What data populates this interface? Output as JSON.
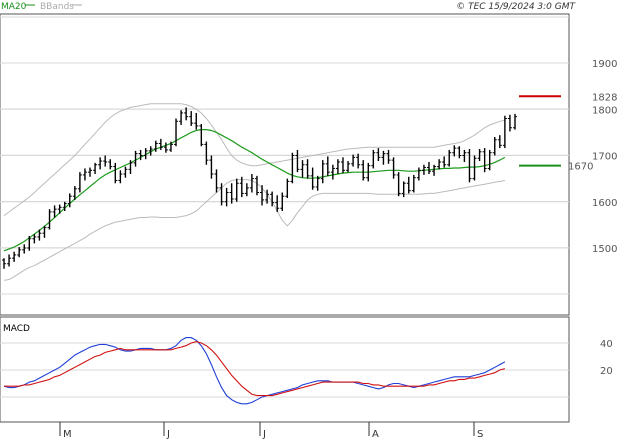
{
  "header": {
    "legend": [
      {
        "label": "MA20",
        "color": "#1a8f1a"
      },
      {
        "label": "BBands",
        "color": "#aaaaaa"
      }
    ],
    "copyright": "© TEC 15/9/2024 3:0 GMT"
  },
  "colors": {
    "price": "#000000",
    "ma20": "#1a9a1a",
    "bbands": "#bbbbbb",
    "grid": "#d8d8d8",
    "resistance": "#cc0000",
    "support": "#1a8f1a",
    "macd": "#1f3fd6",
    "signal": "#d01010"
  },
  "chart_data": [
    {
      "type": "line",
      "ylim": [
        1420,
        1950
      ],
      "yticks": [
        1500,
        1600,
        1700,
        1800,
        1900
      ],
      "xtick_labels": [
        "M",
        "J",
        "J",
        "A",
        "S"
      ],
      "levels": [
        {
          "label": "1828",
          "value": 1828,
          "color": "#cc0000"
        },
        {
          "label": "1670",
          "value": 1678,
          "color": "#1a8f1a"
        }
      ],
      "ohlc": [
        [
          1474,
          1478,
          1455,
          1466
        ],
        [
          1466,
          1486,
          1460,
          1478
        ],
        [
          1478,
          1492,
          1470,
          1485
        ],
        [
          1485,
          1502,
          1480,
          1496
        ],
        [
          1496,
          1508,
          1488,
          1500
        ],
        [
          1500,
          1526,
          1494,
          1520
        ],
        [
          1520,
          1530,
          1510,
          1524
        ],
        [
          1524,
          1540,
          1516,
          1532
        ],
        [
          1532,
          1548,
          1522,
          1544
        ],
        [
          1544,
          1584,
          1540,
          1578
        ],
        [
          1578,
          1592,
          1566,
          1584
        ],
        [
          1584,
          1594,
          1574,
          1588
        ],
        [
          1588,
          1600,
          1580,
          1596
        ],
        [
          1596,
          1618,
          1588,
          1612
        ],
        [
          1612,
          1634,
          1604,
          1628
        ],
        [
          1628,
          1664,
          1620,
          1658
        ],
        [
          1658,
          1672,
          1646,
          1664
        ],
        [
          1664,
          1674,
          1654,
          1668
        ],
        [
          1668,
          1684,
          1660,
          1680
        ],
        [
          1680,
          1696,
          1670,
          1688
        ],
        [
          1688,
          1700,
          1676,
          1686
        ],
        [
          1686,
          1692,
          1670,
          1676
        ],
        [
          1676,
          1684,
          1640,
          1646
        ],
        [
          1646,
          1668,
          1640,
          1660
        ],
        [
          1660,
          1676,
          1652,
          1670
        ],
        [
          1670,
          1690,
          1660,
          1684
        ],
        [
          1684,
          1710,
          1676,
          1704
        ],
        [
          1704,
          1712,
          1690,
          1700
        ],
        [
          1700,
          1716,
          1692,
          1710
        ],
        [
          1710,
          1720,
          1700,
          1714
        ],
        [
          1714,
          1732,
          1708,
          1726
        ],
        [
          1726,
          1736,
          1712,
          1718
        ],
        [
          1718,
          1728,
          1706,
          1712
        ],
        [
          1712,
          1730,
          1708,
          1724
        ],
        [
          1724,
          1780,
          1720,
          1774
        ],
        [
          1774,
          1798,
          1766,
          1792
        ],
        [
          1792,
          1804,
          1776,
          1784
        ],
        [
          1784,
          1796,
          1764,
          1770
        ],
        [
          1770,
          1792,
          1756,
          1764
        ],
        [
          1764,
          1768,
          1720,
          1724
        ],
        [
          1724,
          1730,
          1680,
          1690
        ],
        [
          1690,
          1700,
          1650,
          1660
        ],
        [
          1660,
          1670,
          1620,
          1630
        ],
        [
          1630,
          1640,
          1592,
          1600
        ],
        [
          1600,
          1630,
          1590,
          1620
        ],
        [
          1620,
          1640,
          1596,
          1606
        ],
        [
          1606,
          1650,
          1600,
          1640
        ],
        [
          1640,
          1654,
          1610,
          1618
        ],
        [
          1618,
          1640,
          1612,
          1630
        ],
        [
          1630,
          1660,
          1620,
          1650
        ],
        [
          1650,
          1656,
          1614,
          1620
        ],
        [
          1620,
          1636,
          1592,
          1604
        ],
        [
          1604,
          1626,
          1596,
          1616
        ],
        [
          1616,
          1622,
          1590,
          1598
        ],
        [
          1598,
          1614,
          1578,
          1586
        ],
        [
          1586,
          1620,
          1580,
          1612
        ],
        [
          1612,
          1650,
          1608,
          1644
        ],
        [
          1644,
          1706,
          1640,
          1700
        ],
        [
          1700,
          1712,
          1664,
          1670
        ],
        [
          1670,
          1690,
          1652,
          1680
        ],
        [
          1680,
          1692,
          1650,
          1656
        ],
        [
          1656,
          1674,
          1626,
          1632
        ],
        [
          1632,
          1656,
          1624,
          1650
        ],
        [
          1650,
          1690,
          1640,
          1682
        ],
        [
          1682,
          1698,
          1656,
          1664
        ],
        [
          1664,
          1680,
          1648,
          1672
        ],
        [
          1672,
          1692,
          1660,
          1686
        ],
        [
          1686,
          1696,
          1662,
          1668
        ],
        [
          1668,
          1688,
          1664,
          1682
        ],
        [
          1682,
          1702,
          1676,
          1696
        ],
        [
          1696,
          1704,
          1672,
          1680
        ],
        [
          1680,
          1690,
          1646,
          1652
        ],
        [
          1652,
          1684,
          1644,
          1678
        ],
        [
          1678,
          1712,
          1672,
          1706
        ],
        [
          1706,
          1716,
          1688,
          1696
        ],
        [
          1696,
          1710,
          1680,
          1704
        ],
        [
          1704,
          1712,
          1682,
          1690
        ],
        [
          1690,
          1696,
          1650,
          1658
        ],
        [
          1658,
          1664,
          1612,
          1618
        ],
        [
          1618,
          1644,
          1610,
          1640
        ],
        [
          1640,
          1654,
          1618,
          1624
        ],
        [
          1624,
          1658,
          1620,
          1652
        ],
        [
          1652,
          1674,
          1646,
          1668
        ],
        [
          1668,
          1680,
          1658,
          1674
        ],
        [
          1674,
          1686,
          1660,
          1666
        ],
        [
          1666,
          1680,
          1656,
          1676
        ],
        [
          1676,
          1692,
          1670,
          1686
        ],
        [
          1686,
          1698,
          1674,
          1680
        ],
        [
          1680,
          1712,
          1676,
          1706
        ],
        [
          1706,
          1722,
          1698,
          1716
        ],
        [
          1716,
          1720,
          1694,
          1700
        ],
        [
          1700,
          1712,
          1686,
          1706
        ],
        [
          1706,
          1714,
          1642,
          1650
        ],
        [
          1650,
          1700,
          1646,
          1694
        ],
        [
          1694,
          1714,
          1688,
          1708
        ],
        [
          1708,
          1716,
          1664,
          1672
        ],
        [
          1672,
          1712,
          1668,
          1706
        ],
        [
          1706,
          1740,
          1700,
          1734
        ],
        [
          1734,
          1744,
          1716,
          1722
        ],
        [
          1722,
          1786,
          1716,
          1780
        ],
        [
          1780,
          1788,
          1752,
          1760
        ],
        [
          1760,
          1790,
          1756,
          1784
        ]
      ],
      "ma20": [
        1494,
        1498,
        1502,
        1508,
        1514,
        1522,
        1530,
        1538,
        1547,
        1556,
        1566,
        1576,
        1586,
        1596,
        1606,
        1615,
        1624,
        1633,
        1642,
        1651,
        1658,
        1664,
        1669,
        1674,
        1679,
        1684,
        1690,
        1696,
        1702,
        1708,
        1714,
        1718,
        1722,
        1726,
        1732,
        1738,
        1744,
        1750,
        1754,
        1756,
        1756,
        1754,
        1750,
        1744,
        1738,
        1732,
        1725,
        1718,
        1712,
        1706,
        1699,
        1692,
        1686,
        1680,
        1674,
        1668,
        1662,
        1657,
        1654,
        1652,
        1651,
        1651,
        1652,
        1654,
        1656,
        1658,
        1660,
        1662,
        1663,
        1664,
        1664,
        1664,
        1664,
        1665,
        1666,
        1667,
        1668,
        1668,
        1668,
        1667,
        1666,
        1666,
        1667,
        1668,
        1669,
        1670,
        1671,
        1672,
        1672,
        1673,
        1673,
        1674,
        1675,
        1675,
        1676,
        1678,
        1681,
        1685,
        1690,
        1696
      ],
      "bb_upper": [
        1570,
        1578,
        1586,
        1594,
        1602,
        1610,
        1620,
        1630,
        1640,
        1650,
        1660,
        1670,
        1680,
        1690,
        1700,
        1712,
        1724,
        1736,
        1748,
        1760,
        1772,
        1782,
        1790,
        1796,
        1800,
        1804,
        1806,
        1808,
        1810,
        1812,
        1812,
        1812,
        1812,
        1812,
        1812,
        1812,
        1810,
        1806,
        1800,
        1792,
        1780,
        1766,
        1750,
        1734,
        1716,
        1700,
        1690,
        1684,
        1680,
        1678,
        1678,
        1680,
        1682,
        1684,
        1686,
        1688,
        1690,
        1692,
        1694,
        1696,
        1698,
        1700,
        1702,
        1704,
        1706,
        1708,
        1710,
        1712,
        1714,
        1715,
        1716,
        1717,
        1718,
        1718,
        1718,
        1718,
        1718,
        1718,
        1718,
        1718,
        1718,
        1718,
        1718,
        1718,
        1718,
        1718,
        1720,
        1722,
        1724,
        1726,
        1728,
        1732,
        1738,
        1744,
        1752,
        1760,
        1766,
        1770,
        1774,
        1776
      ],
      "bb_lower": [
        1430,
        1432,
        1438,
        1445,
        1452,
        1458,
        1462,
        1468,
        1474,
        1480,
        1486,
        1492,
        1498,
        1504,
        1510,
        1516,
        1522,
        1530,
        1536,
        1542,
        1548,
        1552,
        1556,
        1558,
        1560,
        1562,
        1564,
        1566,
        1566,
        1567,
        1567,
        1566,
        1566,
        1566,
        1566,
        1568,
        1570,
        1574,
        1580,
        1590,
        1600,
        1610,
        1620,
        1630,
        1640,
        1646,
        1648,
        1648,
        1648,
        1646,
        1640,
        1630,
        1616,
        1600,
        1580,
        1560,
        1548,
        1560,
        1576,
        1590,
        1604,
        1612,
        1616,
        1618,
        1618,
        1618,
        1618,
        1618,
        1618,
        1618,
        1618,
        1618,
        1618,
        1617,
        1616,
        1616,
        1616,
        1616,
        1616,
        1616,
        1616,
        1616,
        1616,
        1617,
        1618,
        1618,
        1620,
        1622,
        1624,
        1626,
        1628,
        1630,
        1632,
        1634,
        1636,
        1638,
        1640,
        1642,
        1644,
        1646
      ]
    },
    {
      "type": "line",
      "title": "MACD",
      "ylim": [
        -5,
        55
      ],
      "yticks": [
        20,
        40
      ],
      "macd": [
        8,
        7,
        7,
        8,
        9,
        11,
        12,
        14,
        16,
        18,
        20,
        22,
        25,
        28,
        31,
        33,
        35,
        37,
        38,
        39,
        39,
        38,
        37,
        35,
        34,
        34,
        35,
        36,
        36,
        36,
        35,
        35,
        35,
        36,
        38,
        42,
        44,
        44,
        42,
        38,
        32,
        24,
        15,
        7,
        1,
        -2,
        -4,
        -5,
        -5,
        -4,
        -2,
        0,
        1,
        2,
        3,
        4,
        5,
        6,
        7,
        9,
        10,
        11,
        12,
        12,
        12,
        11,
        11,
        11,
        11,
        11,
        10,
        9,
        8,
        7,
        6,
        7,
        9,
        10,
        10,
        9,
        8,
        7,
        8,
        9,
        10,
        11,
        12,
        13,
        14,
        15,
        15,
        15,
        15,
        16,
        17,
        18,
        20,
        22,
        24,
        26
      ],
      "signal": [
        8,
        8,
        8,
        8,
        9,
        9,
        10,
        11,
        12,
        13,
        15,
        16,
        18,
        20,
        22,
        24,
        26,
        28,
        30,
        31,
        33,
        34,
        35,
        36,
        35,
        35,
        35,
        35,
        35,
        35,
        35,
        35,
        35,
        35,
        36,
        37,
        38,
        40,
        41,
        40,
        38,
        35,
        31,
        26,
        21,
        16,
        12,
        8,
        5,
        2,
        1,
        1,
        1,
        1,
        2,
        3,
        4,
        5,
        6,
        7,
        8,
        9,
        10,
        11,
        11,
        11,
        11,
        11,
        11,
        11,
        11,
        10,
        10,
        9,
        9,
        8,
        8,
        8,
        8,
        8,
        8,
        8,
        8,
        8,
        9,
        9,
        10,
        11,
        12,
        12,
        13,
        13,
        14,
        14,
        15,
        16,
        17,
        18,
        20,
        21
      ]
    }
  ]
}
